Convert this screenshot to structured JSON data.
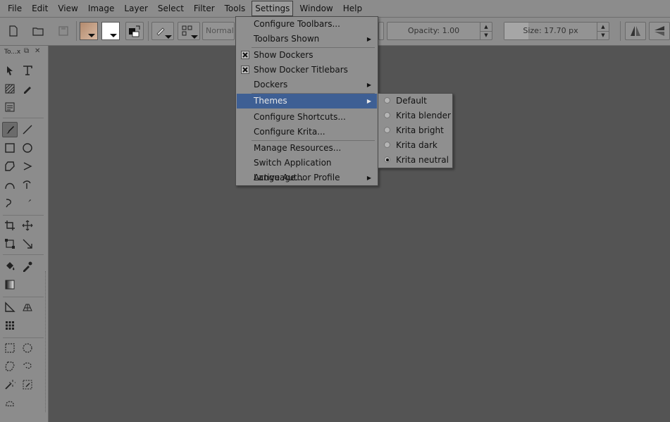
{
  "menubar": {
    "items": [
      {
        "label": "File"
      },
      {
        "label": "Edit"
      },
      {
        "label": "View"
      },
      {
        "label": "Image"
      },
      {
        "label": "Layer"
      },
      {
        "label": "Select"
      },
      {
        "label": "Filter"
      },
      {
        "label": "Tools"
      },
      {
        "label": "Settings"
      },
      {
        "label": "Window"
      },
      {
        "label": "Help"
      }
    ]
  },
  "toolbar": {
    "blend_mode": "Normal",
    "opacity": "Opacity:  1.00",
    "size_label": "Size:  17.70 px"
  },
  "toolbox": {
    "title": "To...x"
  },
  "settings_menu": {
    "items": [
      {
        "label": "Configure Toolbars..."
      },
      {
        "label": "Toolbars Shown"
      },
      {
        "label": "Show Dockers"
      },
      {
        "label": "Show Docker Titlebars"
      },
      {
        "label": "Dockers"
      },
      {
        "label": "Themes"
      },
      {
        "label": "Configure Shortcuts..."
      },
      {
        "label": "Configure Krita..."
      },
      {
        "label": "Manage Resources..."
      },
      {
        "label": "Switch Application Language..."
      },
      {
        "label": "Active Author Profile"
      }
    ]
  },
  "themes_menu": {
    "items": [
      {
        "label": "Default"
      },
      {
        "label": "Krita blender"
      },
      {
        "label": "Krita bright"
      },
      {
        "label": "Krita dark"
      },
      {
        "label": "Krita neutral"
      }
    ],
    "selected": "Krita neutral"
  },
  "colors": {
    "highlight": "#3e5f94",
    "canvas": "#545454",
    "chrome": "#8c8c8c"
  }
}
